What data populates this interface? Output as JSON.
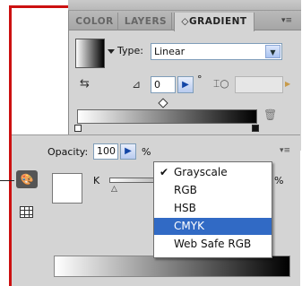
{
  "panel_tabs": [
    "COLOR",
    "LAYERS",
    "◇GRADIENT"
  ],
  "panel_menu_glyph": "▾≡",
  "gradient": {
    "type_label": "Type:",
    "type_value": "Linear",
    "angle_value": "0",
    "degree_symbol": "°",
    "angle_step_glyph": "▶"
  },
  "color_panel": {
    "opacity_label": "Opacity:",
    "opacity_value": "100",
    "opacity_step_glyph": "▶",
    "opacity_unit": "%",
    "channel_label": "K",
    "channel_unit": "%",
    "menu_glyph": "▾≡"
  },
  "color_mode_menu": {
    "items": [
      "Grayscale",
      "RGB",
      "HSB",
      "CMYK",
      "Web Safe RGB"
    ],
    "checked": "Grayscale",
    "check_glyph": "✔",
    "highlighted": "CMYK"
  },
  "colors": {
    "highlight": "#316ac5",
    "frame_red": "#cc1111",
    "panel_bg": "#d4d4d4"
  }
}
